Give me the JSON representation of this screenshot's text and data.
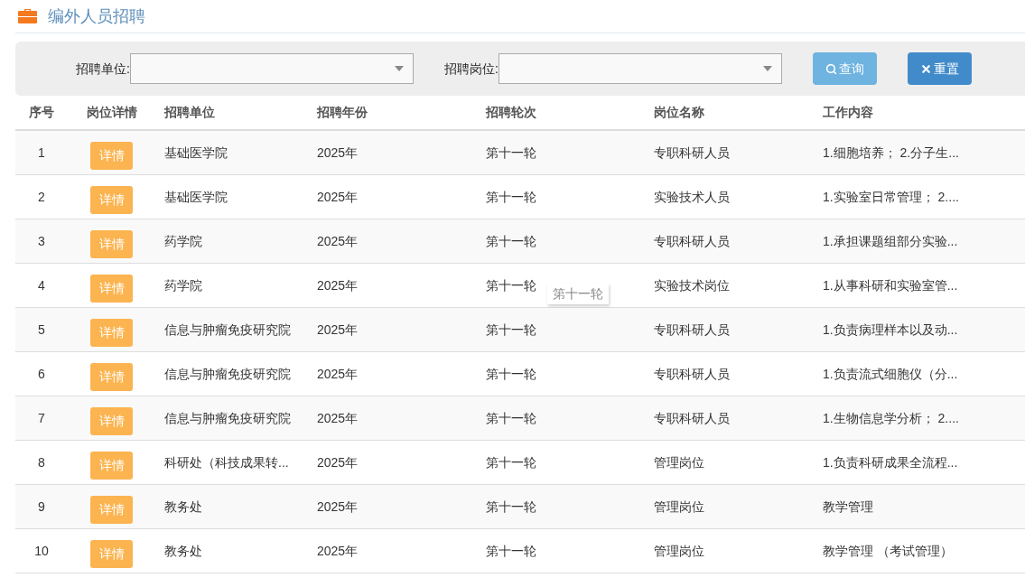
{
  "title": "编外人员招聘",
  "filters": [
    {
      "label": "招聘单位:"
    },
    {
      "label": "招聘岗位:"
    }
  ],
  "buttons": [
    {
      "kind": "search",
      "label": "查询"
    },
    {
      "kind": "reset",
      "label": "重置"
    }
  ],
  "columns": [
    "序号",
    "岗位详情",
    "招聘单位",
    "招聘年份",
    "招聘轮次",
    "岗位名称",
    "工作内容"
  ],
  "rows": [
    {
      "no": "1",
      "detail": "详情",
      "unit": "基础医学院",
      "year": "2025年",
      "round": "第十一轮",
      "post": "专职科研人员",
      "work": "1.细胞培养； 2.分子生..."
    },
    {
      "no": "2",
      "detail": "详情",
      "unit": "基础医学院",
      "year": "2025年",
      "round": "第十一轮",
      "post": "实验技术人员",
      "work": "1.实验室日常管理； 2...."
    },
    {
      "no": "3",
      "detail": "详情",
      "unit": "药学院",
      "year": "2025年",
      "round": "第十一轮",
      "post": "专职科研人员",
      "work": "1.承担课题组部分实验..."
    },
    {
      "no": "4",
      "detail": "详情",
      "unit": "药学院",
      "year": "2025年",
      "round": "第十一轮",
      "tooltip": "第十一轮",
      "post": "实验技术岗位",
      "work": "1.从事科研和实验室管..."
    },
    {
      "no": "5",
      "detail": "详情",
      "unit": "信息与肿瘤免疫研究院",
      "year": "2025年",
      "round": "第十一轮",
      "post": "专职科研人员",
      "work": "1.负责病理样本以及动..."
    },
    {
      "no": "6",
      "detail": "详情",
      "unit": "信息与肿瘤免疫研究院",
      "year": "2025年",
      "round": "第十一轮",
      "post": "专职科研人员",
      "work": "1.负责流式细胞仪（分..."
    },
    {
      "no": "7",
      "detail": "详情",
      "unit": "信息与肿瘤免疫研究院",
      "year": "2025年",
      "round": "第十一轮",
      "post": "专职科研人员",
      "work": "1.生物信息学分析； 2...."
    },
    {
      "no": "8",
      "detail": "详情",
      "unit": "科研处（科技成果转...",
      "year": "2025年",
      "round": "第十一轮",
      "post": "管理岗位",
      "work": "1.负责科研成果全流程..."
    },
    {
      "no": "9",
      "detail": "详情",
      "unit": "教务处",
      "year": "2025年",
      "round": "第十一轮",
      "post": "管理岗位",
      "work": "教学管理"
    },
    {
      "no": "10",
      "detail": "详情",
      "unit": "教务处",
      "year": "2025年",
      "round": "第十一轮",
      "post": "管理岗位",
      "work": "教学管理 （考试管理）"
    }
  ]
}
